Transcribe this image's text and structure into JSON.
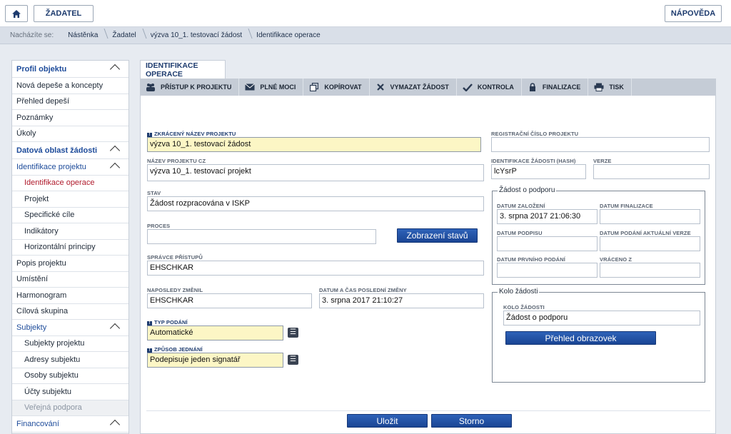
{
  "topbar": {
    "home_icon": "home-icon",
    "zadatel": "ŽADATEL",
    "napoveda": "NÁPOVĚDA"
  },
  "breadcrumb": {
    "prefix": "Nacházíte se:",
    "items": [
      "Nástěnka",
      "Žadatel",
      "výzva 10_1. testovací žádost",
      "Identifikace operace"
    ]
  },
  "sidebar": {
    "items": [
      {
        "label": "Profil objektu",
        "kind": "head",
        "chevron": true
      },
      {
        "label": "Nová depeše a koncepty",
        "kind": "item"
      },
      {
        "label": "Přehled depeší",
        "kind": "item"
      },
      {
        "label": "Poznámky",
        "kind": "item"
      },
      {
        "label": "Úkoly",
        "kind": "item"
      },
      {
        "label": "Datová oblast žádosti",
        "kind": "head",
        "chevron": true
      },
      {
        "label": "Identifikace projektu",
        "kind": "group",
        "chevron": true
      },
      {
        "label": "Identifikace operace",
        "kind": "sub-active"
      },
      {
        "label": "Projekt",
        "kind": "sub"
      },
      {
        "label": "Specifické cíle",
        "kind": "sub"
      },
      {
        "label": "Indikátory",
        "kind": "sub"
      },
      {
        "label": "Horizontální principy",
        "kind": "sub"
      },
      {
        "label": "Popis projektu",
        "kind": "item"
      },
      {
        "label": "Umístění",
        "kind": "item"
      },
      {
        "label": "Harmonogram",
        "kind": "item"
      },
      {
        "label": "Cílová skupina",
        "kind": "item"
      },
      {
        "label": "Subjekty",
        "kind": "group",
        "chevron": true
      },
      {
        "label": "Subjekty projektu",
        "kind": "sub"
      },
      {
        "label": "Adresy subjektu",
        "kind": "sub"
      },
      {
        "label": "Osoby subjektu",
        "kind": "sub"
      },
      {
        "label": "Účty subjektu",
        "kind": "sub"
      },
      {
        "label": "Veřejná podpora",
        "kind": "sub-disabled"
      },
      {
        "label": "Financování",
        "kind": "group",
        "chevron": true
      }
    ]
  },
  "tab": {
    "label": "IDENTIFIKACE OPERACE"
  },
  "toolbar": {
    "items": [
      {
        "label": "PŘÍSTUP K PROJEKTU",
        "icon": "people-icon"
      },
      {
        "label": "PLNÉ MOCI",
        "icon": "mail-icon"
      },
      {
        "label": "KOPÍROVAT",
        "icon": "copy-icon"
      },
      {
        "label": "VYMAZAT ŽÁDOST",
        "icon": "delete-icon"
      },
      {
        "label": "KONTROLA",
        "icon": "check-icon"
      },
      {
        "label": "FINALIZACE",
        "icon": "lock-icon"
      },
      {
        "label": "TISK",
        "icon": "print-icon"
      }
    ]
  },
  "form": {
    "req_badge": "!",
    "zkraceny_nazev": {
      "label": "ZKRÁCENÝ NÁZEV PROJEKTU",
      "value": "výzva 10_1. testovací žádost"
    },
    "nazev_cz": {
      "label": "NÁZEV PROJEKTU CZ",
      "value": "výzva 10_1. testovací projekt"
    },
    "stav": {
      "label": "STAV",
      "value": "Žádost rozpracována v ISKP"
    },
    "proces": {
      "label": "PROCES",
      "value": ""
    },
    "zobrazeni_stavu": "Zobrazení stavů",
    "spravce": {
      "label": "SPRÁVCE PŘÍSTUPŮ",
      "value": "EHSCHKAR"
    },
    "naposledy_zmenil": {
      "label": "NAPOSLEDY ZMĚNIL",
      "value": "EHSCHKAR"
    },
    "datum_zmeny": {
      "label": "DATUM A ČAS POSLEDNÍ ZMĚNY",
      "value": "3. srpna 2017 21:10:27"
    },
    "typ_podani": {
      "label": "TYP PODÁNÍ",
      "value": "Automatické"
    },
    "zpusob_jednani": {
      "label": "ZPŮSOB JEDNÁNÍ",
      "value": "Podepisuje jeden signatář"
    },
    "registracni_cislo": {
      "label": "REGISTRAČNÍ ČÍSLO PROJEKTU",
      "value": ""
    },
    "hash": {
      "label": "IDENTIFIKACE ŽÁDOSTI (HASH)",
      "value": "lcYsrP"
    },
    "verze": {
      "label": "VERZE",
      "value": ""
    },
    "zadost_o_podporu": {
      "title": "Žádost o podporu",
      "datum_zalozeni": {
        "label": "DATUM ZALOŽENÍ",
        "value": "3. srpna 2017 21:06:30"
      },
      "datum_finalizace": {
        "label": "DATUM FINALIZACE",
        "value": ""
      },
      "datum_podpisu": {
        "label": "DATUM PODPISU",
        "value": ""
      },
      "datum_podani_verze": {
        "label": "DATUM PODÁNÍ AKTUÁLNÍ VERZE ŽÁDOSTI",
        "value": ""
      },
      "datum_prvniho_podani": {
        "label": "DATUM PRVNÍHO PODÁNÍ",
        "value": ""
      },
      "vraceno_z": {
        "label": "VRÁCENO Z",
        "value": ""
      }
    },
    "kolo_zadosti": {
      "title": "Kolo žádosti",
      "kolo": {
        "label": "KOLO ŽÁDOSTI",
        "value": "Žádost o podporu"
      },
      "prehled_obrazovek": "Přehled obrazovek"
    },
    "ulozit": "Uložit",
    "storno": "Storno"
  }
}
